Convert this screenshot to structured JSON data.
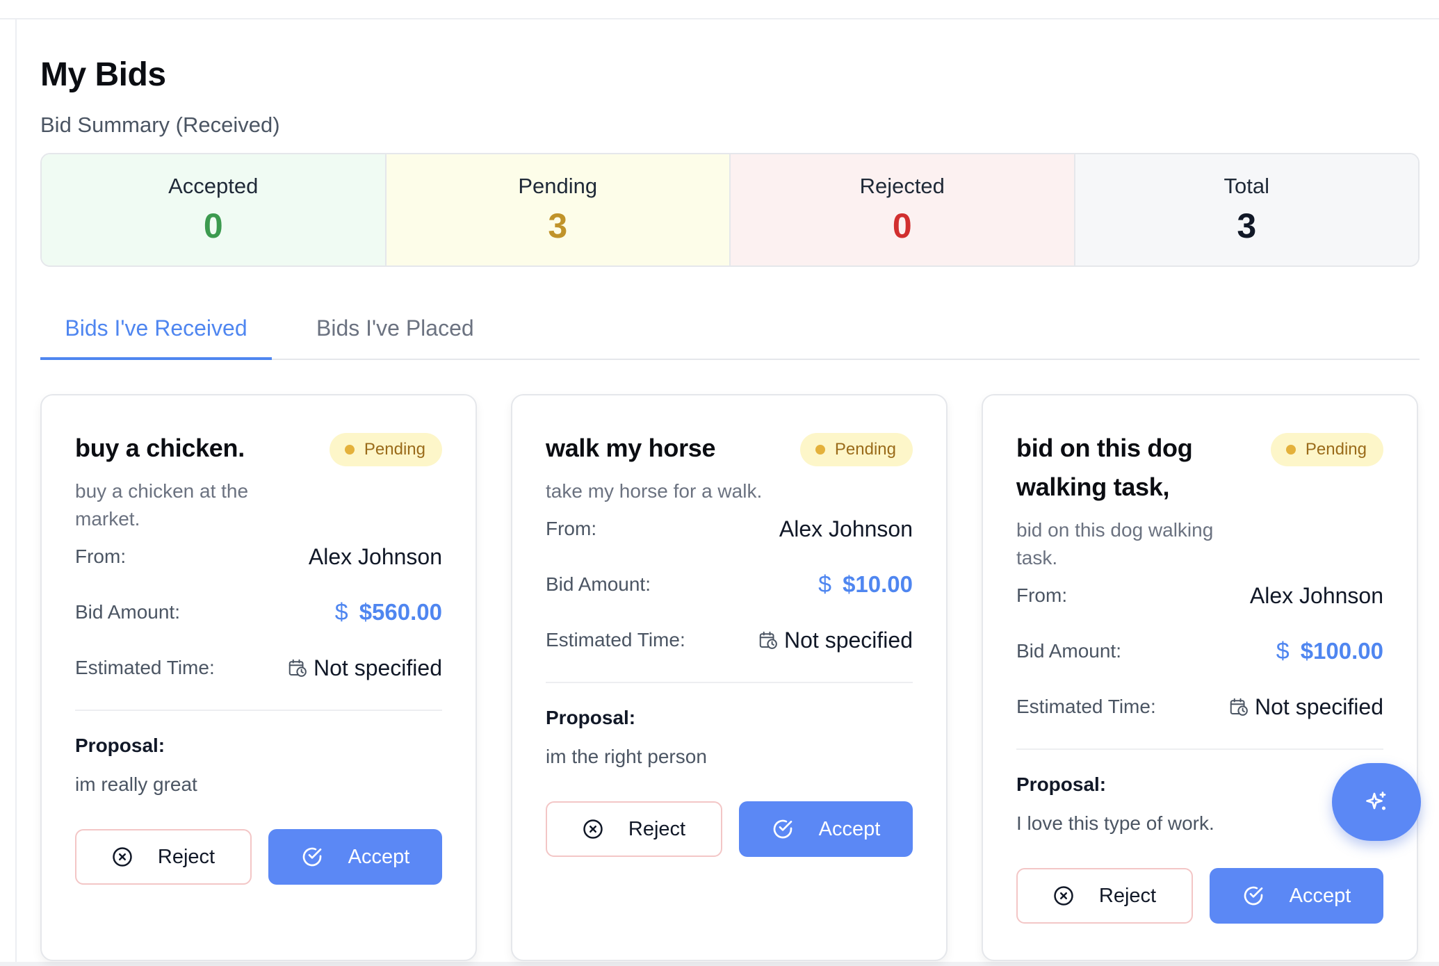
{
  "page": {
    "title": "My Bids",
    "summary_label": "Bid Summary (Received)"
  },
  "summary": [
    {
      "label": "Accepted",
      "value": "0",
      "color": "#3c9a4f"
    },
    {
      "label": "Pending",
      "value": "3",
      "color": "#c0932a"
    },
    {
      "label": "Rejected",
      "value": "0",
      "color": "#d12f2f"
    },
    {
      "label": "Total",
      "value": "3",
      "color": "#111827"
    }
  ],
  "tabs": [
    {
      "label": "Bids I've Received",
      "active": true
    },
    {
      "label": "Bids I've Placed",
      "active": false
    }
  ],
  "labels": {
    "from": "From:",
    "bid_amount": "Bid Amount:",
    "estimated_time": "Estimated Time:",
    "proposal": "Proposal:",
    "reject": "Reject",
    "accept": "Accept",
    "currency_icon": "$"
  },
  "cards": [
    {
      "title": "buy a chicken.",
      "status": "Pending",
      "description": "buy a chicken at the market.",
      "from": "Alex Johnson",
      "amount": "$560.00",
      "estimated_time": "Not specified",
      "proposal": "im really great"
    },
    {
      "title": "walk my horse",
      "status": "Pending",
      "description": "take my horse for a walk.",
      "from": "Alex Johnson",
      "amount": "$10.00",
      "estimated_time": "Not specified",
      "proposal": "im the right person"
    },
    {
      "title": "bid on this dog walking task,",
      "status": "Pending",
      "description": "bid on this dog walking task.",
      "from": "Alex Johnson",
      "amount": "$100.00",
      "estimated_time": "Not specified",
      "proposal": "I love this type of work."
    }
  ],
  "colors": {
    "accent": "#4f86f0",
    "button_primary": "#5b88f5",
    "badge_bg": "#fdf6c9",
    "badge_dot": "#e4b13b"
  },
  "icons": {
    "currency": "dollar-icon",
    "time": "calendar-clock-icon",
    "reject": "x-circle-icon",
    "accept": "check-circle-icon",
    "fab": "sparkles-icon"
  }
}
